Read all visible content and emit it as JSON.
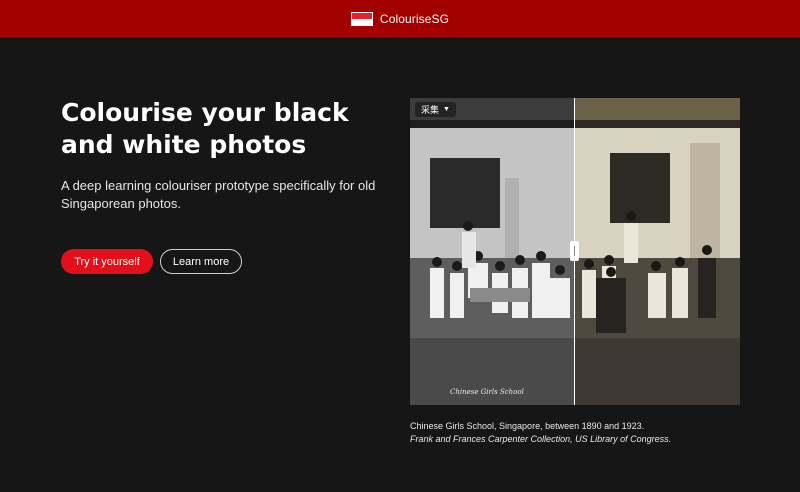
{
  "header": {
    "brand_name": "ColouriseSG",
    "logo_icon": "singapore-flag-icon"
  },
  "hero": {
    "title": "Colourise your black and white photos",
    "subtitle": "A deep learning colouriser prototype specifically for old Singaporean photos.",
    "primary_button": "Try it yourself",
    "secondary_button": "Learn more"
  },
  "comparison": {
    "language_selector": "采集",
    "photo_inscription": "Chinese Girls School",
    "split_percent": 50
  },
  "caption": {
    "line1": "Chinese Girls School, Singapore, between 1890 and 1923.",
    "line2": "Frank and Frances Carpenter Collection, US Library of Congress."
  },
  "colors": {
    "header_bg": "#a30000",
    "page_bg": "#161617",
    "primary_button": "#e3101b"
  }
}
